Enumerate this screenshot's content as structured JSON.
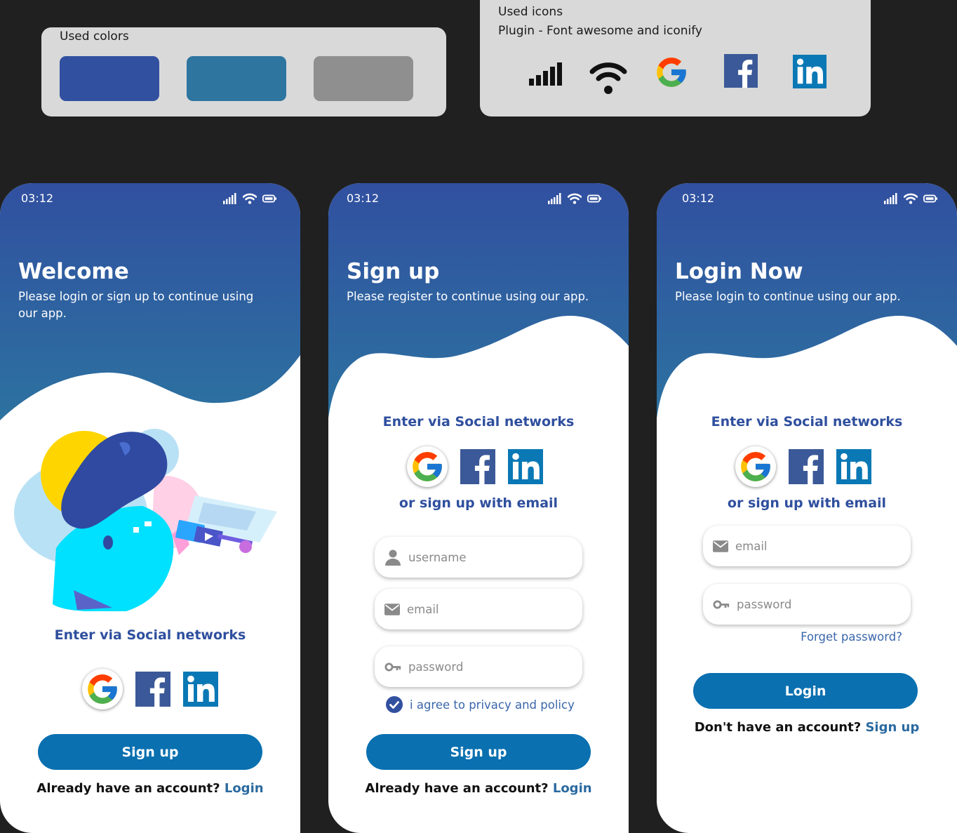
{
  "colors_panel": {
    "title": "Used colors",
    "swatches": [
      "#3150a0",
      "#2e75a0",
      "#8f8f8f"
    ]
  },
  "icons_panel": {
    "title": "Used  icons",
    "plugin": "Plugin - Font awesome and iconify",
    "icons": [
      "signal-icon",
      "wifi-icon",
      "google-icon",
      "facebook-icon",
      "linkedin-icon"
    ]
  },
  "theme": {
    "primary": "#3150a0",
    "secondary": "#2e75a0",
    "button": "#0a70b0",
    "link": "#2b6aa0"
  },
  "welcome": {
    "time": "03:12",
    "title": "Welcome",
    "subtitle": "Please login or sign up to continue using our app.",
    "social_title": "Enter via Social networks",
    "button": "Sign up",
    "footer_text": "Already have an account?",
    "footer_link": "Login"
  },
  "signup": {
    "time": "03:12",
    "title": "Sign up",
    "subtitle": "Please register to continue using our app.",
    "social_title": "Enter via Social networks",
    "email_title": "or sign up with email",
    "username_placeholder": "username",
    "email_placeholder": "email",
    "password_placeholder": "password",
    "agree": "i agree to privacy and policy",
    "button": "Sign up",
    "footer_text": "Already have an account?",
    "footer_link": "Login"
  },
  "login": {
    "time": "03:12",
    "title": "Login Now",
    "subtitle": "Please login to continue using our app.",
    "social_title": "Enter via Social networks",
    "email_title": "or sign up with email",
    "email_placeholder": "email",
    "password_placeholder": "password",
    "forgot": "Forget  password?",
    "button": "Login",
    "footer_text": "Don't have an account?",
    "footer_link": "Sign up"
  }
}
